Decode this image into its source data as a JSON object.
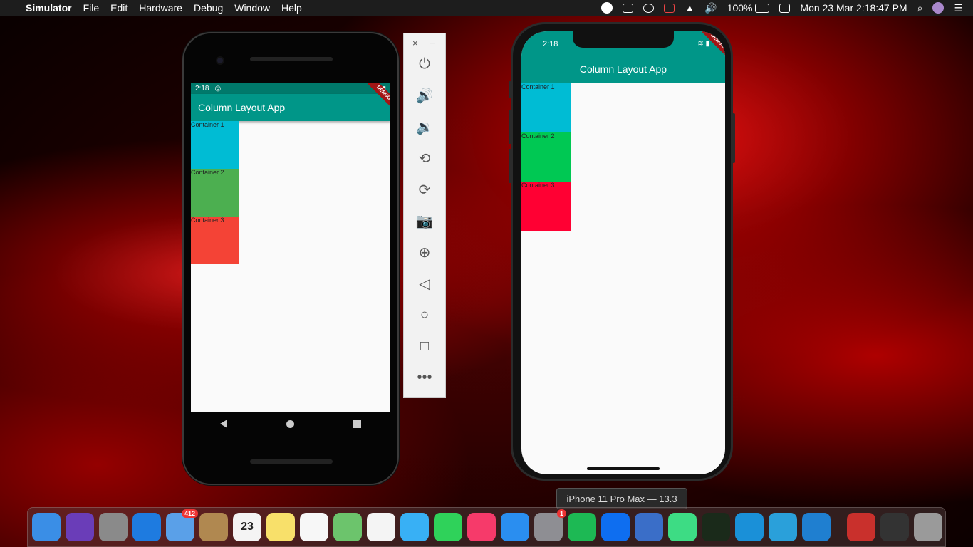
{
  "menubar": {
    "apple_glyph": "",
    "app_name": "Simulator",
    "items": [
      "File",
      "Edit",
      "Hardware",
      "Debug",
      "Window",
      "Help"
    ],
    "battery": "100%",
    "datetime": "Mon 23 Mar  2:18:47 PM"
  },
  "android": {
    "time": "2:18",
    "app_title": "Column Layout App",
    "debug_label": "DEBUG",
    "containers": [
      {
        "label": "Container 1",
        "color": "#00bcd4"
      },
      {
        "label": "Container 2",
        "color": "#4caf50"
      },
      {
        "label": "Container 3",
        "color": "#f44336"
      }
    ]
  },
  "emulator_toolbar": {
    "close": "×",
    "minimize": "−",
    "buttons": [
      {
        "name": "power-icon",
        "glyph": "⏻"
      },
      {
        "name": "volume-up-icon",
        "glyph": "🔊"
      },
      {
        "name": "volume-down-icon",
        "glyph": "🔉"
      },
      {
        "name": "rotate-left-icon",
        "glyph": "⟲"
      },
      {
        "name": "rotate-right-icon",
        "glyph": "⟳"
      },
      {
        "name": "camera-icon",
        "glyph": "📷"
      },
      {
        "name": "zoom-icon",
        "glyph": "⊕"
      },
      {
        "name": "back-icon",
        "glyph": "◁"
      },
      {
        "name": "home-icon",
        "glyph": "○"
      },
      {
        "name": "overview-icon",
        "glyph": "□"
      },
      {
        "name": "more-icon",
        "glyph": "•••"
      }
    ]
  },
  "iphone": {
    "time": "2:18",
    "app_title": "Column Layout App",
    "debug_label": "DEBUG",
    "containers": [
      {
        "label": "Container 1",
        "color": "#00bcd4"
      },
      {
        "label": "Container 2",
        "color": "#00c853"
      },
      {
        "label": "Container 3",
        "color": "#ff0033"
      }
    ]
  },
  "tooltip": "iPhone 11 Pro Max — 13.3",
  "dock": {
    "items": [
      {
        "name": "finder",
        "color": "#3a8ee6"
      },
      {
        "name": "siri",
        "color": "#6a3db8"
      },
      {
        "name": "launchpad",
        "color": "#8a8a8a"
      },
      {
        "name": "safari",
        "color": "#1e7be0"
      },
      {
        "name": "mail",
        "color": "#5aa0e8",
        "badge": "412"
      },
      {
        "name": "contacts",
        "color": "#b08850"
      },
      {
        "name": "calendar",
        "color": "#f4f4f4",
        "text": "23"
      },
      {
        "name": "notes",
        "color": "#f8e06a"
      },
      {
        "name": "reminders",
        "color": "#f7f7f7"
      },
      {
        "name": "maps",
        "color": "#6cc46c"
      },
      {
        "name": "photos",
        "color": "#f4f4f4"
      },
      {
        "name": "messages",
        "color": "#38b0f5"
      },
      {
        "name": "facetime",
        "color": "#2fd25a"
      },
      {
        "name": "itunes",
        "color": "#f63a6a"
      },
      {
        "name": "app-store",
        "color": "#2a8ef0"
      },
      {
        "name": "system-preferences",
        "color": "#8e8e93",
        "badge": "1"
      },
      {
        "name": "spotify",
        "color": "#1db954"
      },
      {
        "name": "teamviewer",
        "color": "#0e6ef0"
      },
      {
        "name": "xcode-instruments",
        "color": "#3a6ec8"
      },
      {
        "name": "android-studio",
        "color": "#3ddc84"
      },
      {
        "name": "activity-monitor",
        "color": "#1a2a1a"
      },
      {
        "name": "edge",
        "color": "#1a90d8"
      },
      {
        "name": "telegram",
        "color": "#2aa0da"
      },
      {
        "name": "vscode",
        "color": "#1f7fd0"
      }
    ],
    "right_items": [
      {
        "name": "screenshot-file",
        "color": "#c9302c"
      },
      {
        "name": "terminal-window",
        "color": "#333333"
      },
      {
        "name": "trash",
        "color": "#9a9a9a"
      }
    ]
  }
}
